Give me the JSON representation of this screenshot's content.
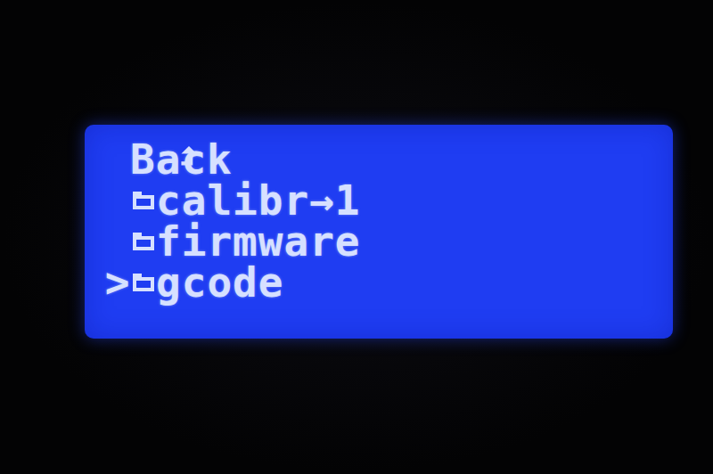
{
  "screen": {
    "cursor": ">",
    "items": [
      {
        "label": "Back",
        "kind": "back",
        "selected": false
      },
      {
        "label": "calibr→1",
        "kind": "folder",
        "selected": false
      },
      {
        "label": "firmware",
        "kind": "folder",
        "selected": false
      },
      {
        "label": "gcode",
        "kind": "folder",
        "selected": true
      }
    ]
  }
}
